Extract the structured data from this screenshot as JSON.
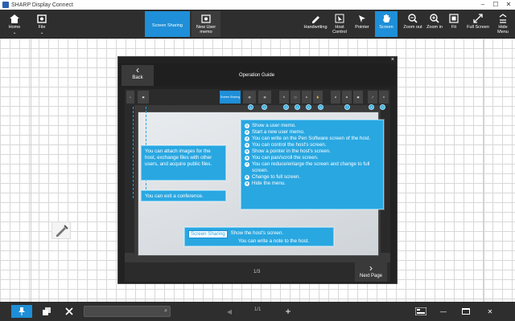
{
  "window": {
    "title": "SHARP Display Connect",
    "minimize": "–",
    "maximize": "☐",
    "close": "✕"
  },
  "toolbar": {
    "home": "Home",
    "file": "File",
    "screen_sharing": "Screen Sharing",
    "new_user_memo": "New User memo",
    "handwriting": "Handwriting",
    "host_control": "Host Control",
    "pointer": "Pointer",
    "screen": "Screen",
    "zoom_out": "Zoom out",
    "zoom_in": "Zoom in",
    "fit": "Fit",
    "full_screen": "Full Screen",
    "hide_menu": "Hide Menu"
  },
  "guide": {
    "close": "×",
    "back_label": "Back",
    "title": "Operation Guide",
    "mini_screen_sharing": "Screen Sharing",
    "page": "1/3",
    "next_label": "Next Page"
  },
  "callouts": {
    "left_top": "You can attach images for the host, exchange files with other users, and acquire public files.",
    "left_bottom": "You can exit a conference.",
    "right_items": [
      {
        "n": "1",
        "text": "Show a user memo."
      },
      {
        "n": "2",
        "text": "Start a new user memo."
      },
      {
        "n": "3",
        "text": "You can write on the Pen Software screen of the host."
      },
      {
        "n": "4",
        "text": "You can control the host's screen."
      },
      {
        "n": "5",
        "text": "Show a pointer in the host's screen."
      },
      {
        "n": "6",
        "text": "You can pan/scroll the screen."
      },
      {
        "n": "7",
        "text": "You can reduce/enlarge the screen and change to full screen."
      },
      {
        "n": "8",
        "text": "Change to full screen."
      },
      {
        "n": "9",
        "text": "Hide the menu."
      }
    ],
    "bottom_tag": "Screen Sharing",
    "bottom_line1": "Show the host's screen.",
    "bottom_line2": "You can write a note to the host."
  },
  "statusbar": {
    "search_placeholder": "",
    "page": "1/1",
    "add": "+"
  },
  "colors": {
    "accent": "#1e8fd8",
    "callout": "#29a7e1",
    "toolbar": "#2e2e2e"
  }
}
